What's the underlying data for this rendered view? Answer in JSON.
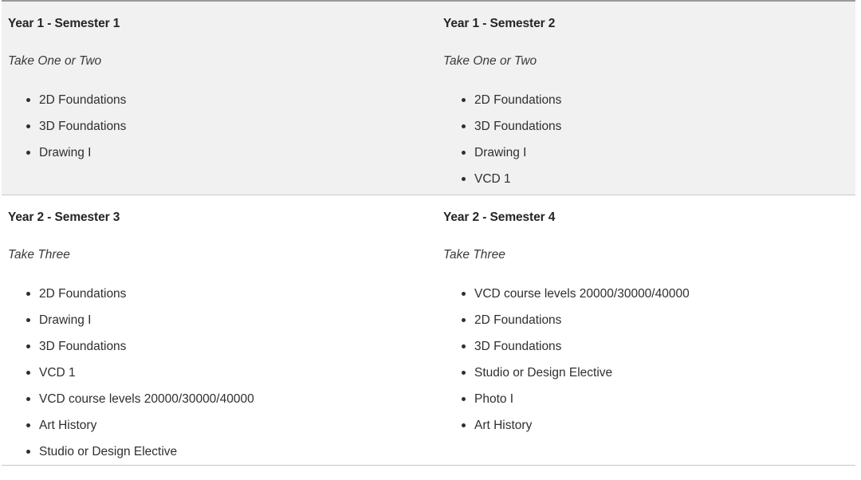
{
  "table": {
    "rows": [
      {
        "shaded": true,
        "cells": [
          {
            "title": "Year 1 - Semester 1",
            "note": "Take One or Two",
            "courses": [
              "2D Foundations",
              "3D Foundations",
              "Drawing I"
            ]
          },
          {
            "title": "Year 1 - Semester 2",
            "note": "Take One or Two",
            "courses": [
              "2D Foundations",
              "3D Foundations",
              "Drawing I",
              "VCD 1"
            ]
          }
        ]
      },
      {
        "shaded": false,
        "cells": [
          {
            "title": "Year 2 - Semester 3",
            "note": "Take Three",
            "courses": [
              "2D Foundations",
              "Drawing I",
              "3D Foundations",
              "VCD 1",
              "VCD course levels 20000/30000/40000",
              "Art History",
              "Studio or Design Elective"
            ]
          },
          {
            "title": "Year 2 - Semester 4",
            "note": "Take Three",
            "courses": [
              "VCD course levels 20000/30000/40000",
              "2D Foundations",
              "3D Foundations",
              "Studio or Design Elective",
              "Photo I",
              "Art History"
            ]
          }
        ]
      }
    ]
  },
  "icons": {
    "bullet": "list-bullet-icon"
  },
  "colors": {
    "shaded_row_background": "#f1f1f1",
    "plain_row_background": "#ffffff",
    "border": "#c8c8c8",
    "top_border": "#9a9a9a",
    "text": "#2f2f2f",
    "heading_text": "#252525"
  }
}
